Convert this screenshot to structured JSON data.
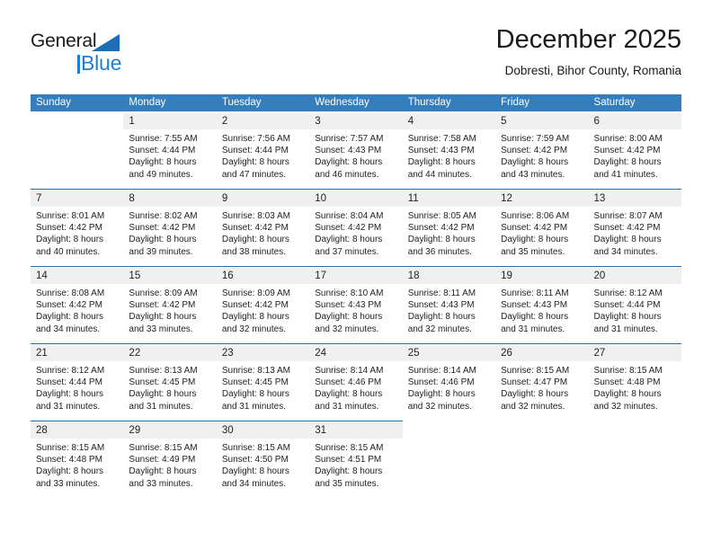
{
  "brand": {
    "name_part1": "General",
    "name_part2": "Blue",
    "triangle_color": "#1c6fb5",
    "blue_color": "#1c7fd6"
  },
  "header": {
    "title": "December 2025",
    "subtitle": "Dobresti, Bihor County, Romania"
  },
  "theme": {
    "header_bg": "#357ebd",
    "daynum_bg": "#f0f0f0",
    "week_rule": "#1f6cb0",
    "text": "#222222"
  },
  "weekday_headers": [
    "Sunday",
    "Monday",
    "Tuesday",
    "Wednesday",
    "Thursday",
    "Friday",
    "Saturday"
  ],
  "weeks": [
    {
      "days": [
        {
          "num": "",
          "lines": []
        },
        {
          "num": "1",
          "lines": [
            "Sunrise: 7:55 AM",
            "Sunset: 4:44 PM",
            "Daylight: 8 hours",
            "and 49 minutes."
          ]
        },
        {
          "num": "2",
          "lines": [
            "Sunrise: 7:56 AM",
            "Sunset: 4:44 PM",
            "Daylight: 8 hours",
            "and 47 minutes."
          ]
        },
        {
          "num": "3",
          "lines": [
            "Sunrise: 7:57 AM",
            "Sunset: 4:43 PM",
            "Daylight: 8 hours",
            "and 46 minutes."
          ]
        },
        {
          "num": "4",
          "lines": [
            "Sunrise: 7:58 AM",
            "Sunset: 4:43 PM",
            "Daylight: 8 hours",
            "and 44 minutes."
          ]
        },
        {
          "num": "5",
          "lines": [
            "Sunrise: 7:59 AM",
            "Sunset: 4:42 PM",
            "Daylight: 8 hours",
            "and 43 minutes."
          ]
        },
        {
          "num": "6",
          "lines": [
            "Sunrise: 8:00 AM",
            "Sunset: 4:42 PM",
            "Daylight: 8 hours",
            "and 41 minutes."
          ]
        }
      ]
    },
    {
      "days": [
        {
          "num": "7",
          "lines": [
            "Sunrise: 8:01 AM",
            "Sunset: 4:42 PM",
            "Daylight: 8 hours",
            "and 40 minutes."
          ]
        },
        {
          "num": "8",
          "lines": [
            "Sunrise: 8:02 AM",
            "Sunset: 4:42 PM",
            "Daylight: 8 hours",
            "and 39 minutes."
          ]
        },
        {
          "num": "9",
          "lines": [
            "Sunrise: 8:03 AM",
            "Sunset: 4:42 PM",
            "Daylight: 8 hours",
            "and 38 minutes."
          ]
        },
        {
          "num": "10",
          "lines": [
            "Sunrise: 8:04 AM",
            "Sunset: 4:42 PM",
            "Daylight: 8 hours",
            "and 37 minutes."
          ]
        },
        {
          "num": "11",
          "lines": [
            "Sunrise: 8:05 AM",
            "Sunset: 4:42 PM",
            "Daylight: 8 hours",
            "and 36 minutes."
          ]
        },
        {
          "num": "12",
          "lines": [
            "Sunrise: 8:06 AM",
            "Sunset: 4:42 PM",
            "Daylight: 8 hours",
            "and 35 minutes."
          ]
        },
        {
          "num": "13",
          "lines": [
            "Sunrise: 8:07 AM",
            "Sunset: 4:42 PM",
            "Daylight: 8 hours",
            "and 34 minutes."
          ]
        }
      ]
    },
    {
      "days": [
        {
          "num": "14",
          "lines": [
            "Sunrise: 8:08 AM",
            "Sunset: 4:42 PM",
            "Daylight: 8 hours",
            "and 34 minutes."
          ]
        },
        {
          "num": "15",
          "lines": [
            "Sunrise: 8:09 AM",
            "Sunset: 4:42 PM",
            "Daylight: 8 hours",
            "and 33 minutes."
          ]
        },
        {
          "num": "16",
          "lines": [
            "Sunrise: 8:09 AM",
            "Sunset: 4:42 PM",
            "Daylight: 8 hours",
            "and 32 minutes."
          ]
        },
        {
          "num": "17",
          "lines": [
            "Sunrise: 8:10 AM",
            "Sunset: 4:43 PM",
            "Daylight: 8 hours",
            "and 32 minutes."
          ]
        },
        {
          "num": "18",
          "lines": [
            "Sunrise: 8:11 AM",
            "Sunset: 4:43 PM",
            "Daylight: 8 hours",
            "and 32 minutes."
          ]
        },
        {
          "num": "19",
          "lines": [
            "Sunrise: 8:11 AM",
            "Sunset: 4:43 PM",
            "Daylight: 8 hours",
            "and 31 minutes."
          ]
        },
        {
          "num": "20",
          "lines": [
            "Sunrise: 8:12 AM",
            "Sunset: 4:44 PM",
            "Daylight: 8 hours",
            "and 31 minutes."
          ]
        }
      ]
    },
    {
      "days": [
        {
          "num": "21",
          "lines": [
            "Sunrise: 8:12 AM",
            "Sunset: 4:44 PM",
            "Daylight: 8 hours",
            "and 31 minutes."
          ]
        },
        {
          "num": "22",
          "lines": [
            "Sunrise: 8:13 AM",
            "Sunset: 4:45 PM",
            "Daylight: 8 hours",
            "and 31 minutes."
          ]
        },
        {
          "num": "23",
          "lines": [
            "Sunrise: 8:13 AM",
            "Sunset: 4:45 PM",
            "Daylight: 8 hours",
            "and 31 minutes."
          ]
        },
        {
          "num": "24",
          "lines": [
            "Sunrise: 8:14 AM",
            "Sunset: 4:46 PM",
            "Daylight: 8 hours",
            "and 31 minutes."
          ]
        },
        {
          "num": "25",
          "lines": [
            "Sunrise: 8:14 AM",
            "Sunset: 4:46 PM",
            "Daylight: 8 hours",
            "and 32 minutes."
          ]
        },
        {
          "num": "26",
          "lines": [
            "Sunrise: 8:15 AM",
            "Sunset: 4:47 PM",
            "Daylight: 8 hours",
            "and 32 minutes."
          ]
        },
        {
          "num": "27",
          "lines": [
            "Sunrise: 8:15 AM",
            "Sunset: 4:48 PM",
            "Daylight: 8 hours",
            "and 32 minutes."
          ]
        }
      ]
    },
    {
      "days": [
        {
          "num": "28",
          "lines": [
            "Sunrise: 8:15 AM",
            "Sunset: 4:48 PM",
            "Daylight: 8 hours",
            "and 33 minutes."
          ]
        },
        {
          "num": "29",
          "lines": [
            "Sunrise: 8:15 AM",
            "Sunset: 4:49 PM",
            "Daylight: 8 hours",
            "and 33 minutes."
          ]
        },
        {
          "num": "30",
          "lines": [
            "Sunrise: 8:15 AM",
            "Sunset: 4:50 PM",
            "Daylight: 8 hours",
            "and 34 minutes."
          ]
        },
        {
          "num": "31",
          "lines": [
            "Sunrise: 8:15 AM",
            "Sunset: 4:51 PM",
            "Daylight: 8 hours",
            "and 35 minutes."
          ]
        },
        {
          "num": "",
          "lines": []
        },
        {
          "num": "",
          "lines": []
        },
        {
          "num": "",
          "lines": []
        }
      ]
    }
  ]
}
